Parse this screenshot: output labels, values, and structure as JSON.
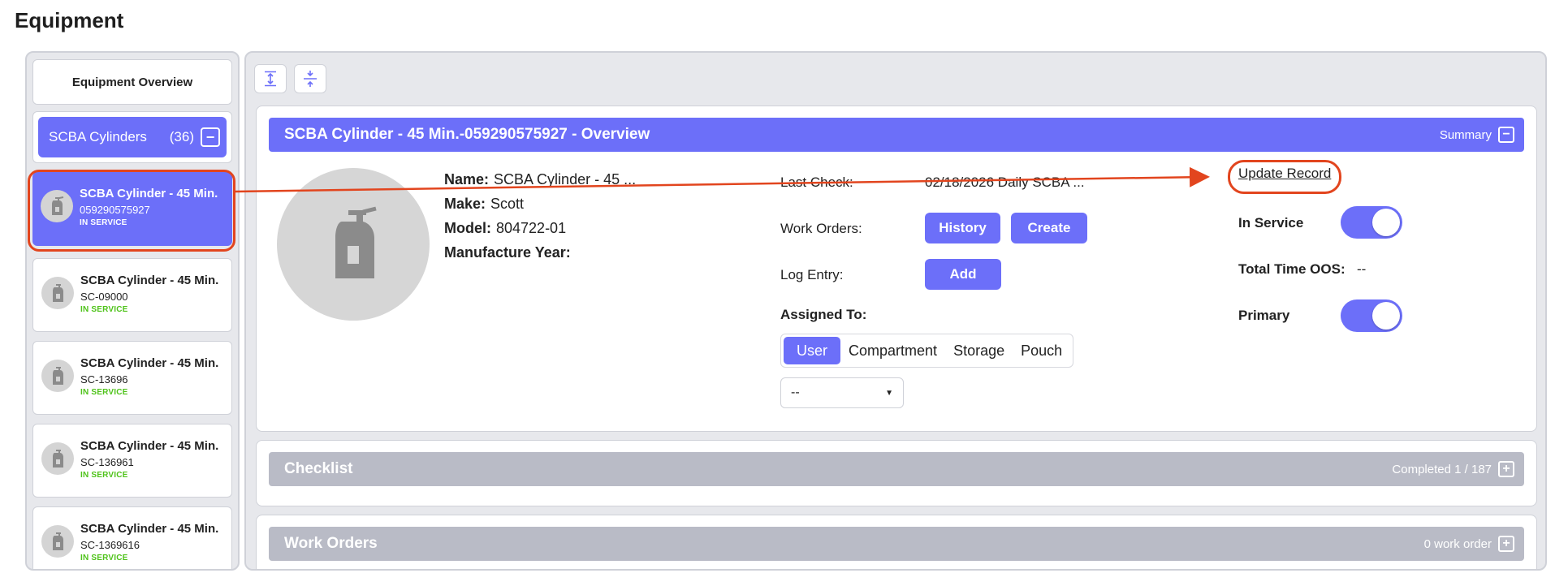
{
  "page": {
    "title": "Equipment"
  },
  "sidebar": {
    "overview_label": "Equipment Overview",
    "group": {
      "name": "SCBA Cylinders",
      "count": "(36)",
      "toggle_symbol": "−"
    },
    "items": [
      {
        "name": "SCBA Cylinder - 45 Min.",
        "id": "059290575927",
        "status": "IN SERVICE",
        "active": true
      },
      {
        "name": "SCBA Cylinder - 45 Min.",
        "id": "SC-09000",
        "status": "IN SERVICE",
        "active": false
      },
      {
        "name": "SCBA Cylinder - 45 Min.",
        "id": "SC-13696",
        "status": "IN SERVICE",
        "active": false
      },
      {
        "name": "SCBA Cylinder - 45 Min.",
        "id": "SC-136961",
        "status": "IN SERVICE",
        "active": false
      },
      {
        "name": "SCBA Cylinder - 45 Min.",
        "id": "SC-1369616",
        "status": "IN SERVICE",
        "active": false
      }
    ]
  },
  "toolbar": {
    "expand_all_icon": "expand-vertical-icon",
    "collapse_all_icon": "collapse-vertical-icon"
  },
  "overview": {
    "header_title": "SCBA Cylinder - 45 Min.-059290575927 - Overview",
    "header_right": "Summary",
    "header_toggle": "−",
    "fields": {
      "name_label": "Name:",
      "name_value": "SCBA Cylinder - 45 ...",
      "make_label": "Make:",
      "make_value": "Scott",
      "model_label": "Model:",
      "model_value": "804722-01",
      "year_label": "Manufacture Year:",
      "year_value": ""
    },
    "last_check_label": "Last Check:",
    "last_check_value": "02/18/2026 Daily SCBA ...",
    "work_orders_label": "Work Orders:",
    "history_button": "History",
    "create_button": "Create",
    "log_entry_label": "Log Entry:",
    "add_button": "Add",
    "assigned_to_label": "Assigned To:",
    "assign_options": [
      "User",
      "Compartment",
      "Storage",
      "Pouch"
    ],
    "assign_selected": "User",
    "user_select_value": "--",
    "update_record_link": "Update Record",
    "in_service_label": "In Service",
    "in_service_on": true,
    "total_time_label": "Total Time OOS:",
    "total_time_value": "--",
    "primary_label": "Primary",
    "primary_on": true
  },
  "checklist": {
    "title": "Checklist",
    "right": "Completed 1 / 187",
    "toggle": "+"
  },
  "work_orders": {
    "title": "Work Orders",
    "right": "0 work order",
    "toggle": "+"
  },
  "colors": {
    "accent": "#6c6ff9",
    "status_green": "#4fc31a",
    "callout": "#e2451e",
    "collapsed_header": "#b9bbc6"
  }
}
